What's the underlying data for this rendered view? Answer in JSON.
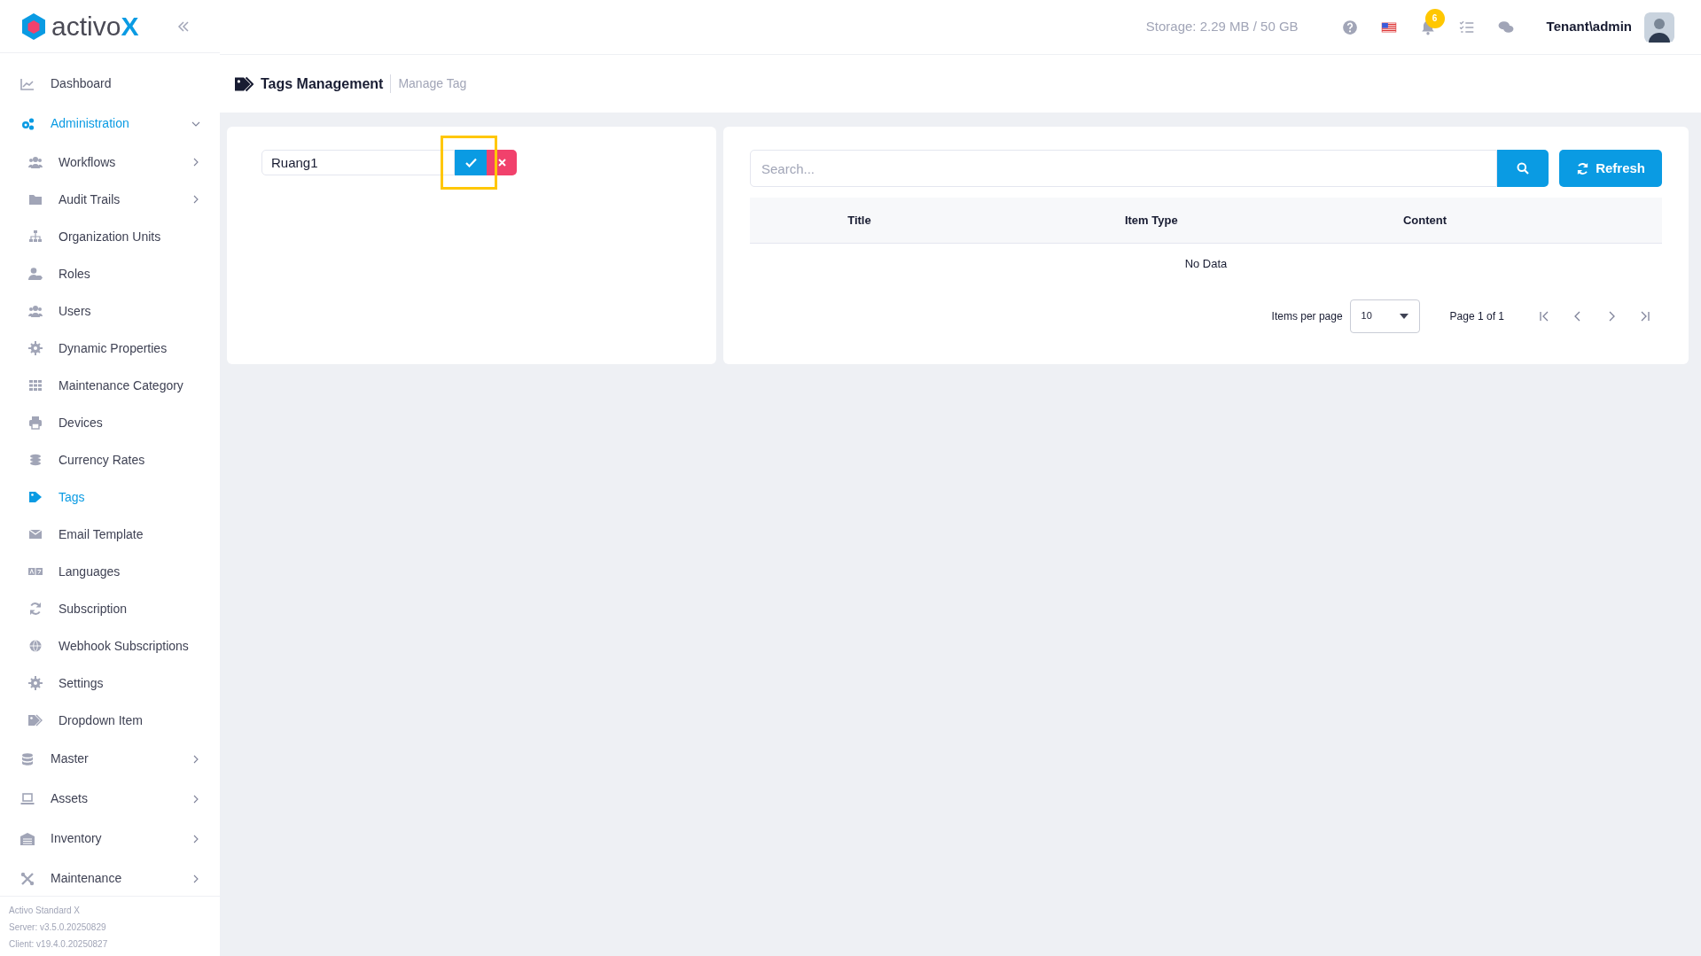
{
  "sidebar": {
    "logo": {
      "name": "activo",
      "accent": "X"
    },
    "items": [
      {
        "label": "Dashboard",
        "selected": false
      },
      {
        "label": "Administration",
        "selected": true,
        "expanded": true,
        "children": [
          {
            "label": "Workflows",
            "selected": false,
            "expanded": false
          },
          {
            "label": "Audit Trails",
            "selected": false,
            "expanded": false
          },
          {
            "label": "Organization Units",
            "selected": false
          },
          {
            "label": "Roles",
            "selected": false
          },
          {
            "label": "Users",
            "selected": false
          },
          {
            "label": "Dynamic Properties",
            "selected": false
          },
          {
            "label": "Maintenance Category",
            "selected": false
          },
          {
            "label": "Devices",
            "selected": false
          },
          {
            "label": "Currency Rates",
            "selected": false
          },
          {
            "label": "Tags",
            "selected": true
          },
          {
            "label": "Email Template",
            "selected": false
          },
          {
            "label": "Languages",
            "selected": false
          },
          {
            "label": "Subscription",
            "selected": false
          },
          {
            "label": "Webhook Subscriptions",
            "selected": false
          },
          {
            "label": "Settings",
            "selected": false
          },
          {
            "label": "Dropdown Item",
            "selected": false
          }
        ]
      },
      {
        "label": "Master",
        "selected": false,
        "expanded": false
      },
      {
        "label": "Assets",
        "selected": false,
        "expanded": false
      },
      {
        "label": "Inventory",
        "selected": false,
        "expanded": false
      },
      {
        "label": "Maintenance",
        "selected": false,
        "expanded": false
      }
    ],
    "footer": [
      "Activo Standard X",
      "Server: v3.5.0.20250829",
      "Client: v19.4.0.20250827"
    ]
  },
  "header": {
    "storage": "Storage: 2.29 MB / 50 GB",
    "notification_count": "6",
    "user": "Tenant\\admin"
  },
  "page": {
    "title": "Tags Management",
    "subtitle": "Manage Tag"
  },
  "editor": {
    "value": "Ruang1",
    "confirm_highlighted": true
  },
  "search": {
    "placeholder": "Search...",
    "refresh": "Refresh"
  },
  "table": {
    "columns": [
      "Title",
      "Item Type",
      "Content"
    ],
    "empty_text": "No Data"
  },
  "paginator": {
    "label": "Items per page",
    "page_size": "10",
    "range": "Page 1 of 1"
  }
}
